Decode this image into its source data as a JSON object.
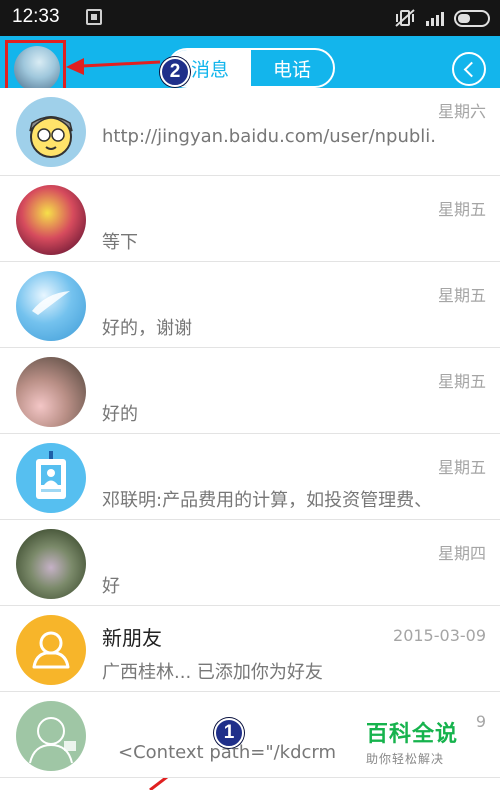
{
  "status_bar": {
    "time": "12:33"
  },
  "header": {
    "tabs": [
      {
        "label": "消息",
        "active": true
      },
      {
        "label": "电话",
        "active": false
      }
    ],
    "accent_color": "#13b5ec"
  },
  "annotations": {
    "badge_1": "1",
    "badge_2": "2",
    "highlight_color": "#e02020"
  },
  "conversations": [
    {
      "name": "",
      "date": "星期六",
      "message": "http://jingyan.baidu.com/user/npubli.",
      "avatar_icon": "cartoon-avatar"
    },
    {
      "name": "",
      "date": "星期五",
      "message": "等下",
      "avatar_icon": "gift-photo-avatar"
    },
    {
      "name": "",
      "date": "星期五",
      "message": "好的，谢谢",
      "avatar_icon": "feather-sky-avatar"
    },
    {
      "name": "",
      "date": "星期五",
      "message": "好的",
      "avatar_icon": "child-photo-avatar"
    },
    {
      "name": "",
      "date": "星期五",
      "message": "邓联明:产品费用的计算，如投资管理费、",
      "avatar_icon": "id-badge-avatar"
    },
    {
      "name": "",
      "date": "星期四",
      "message": "好",
      "avatar_icon": "garden-photo-avatar"
    },
    {
      "name": "新朋友",
      "date": "2015-03-09",
      "message": "广西桂林... 已添加你为好友",
      "avatar_icon": "new-friend-icon"
    },
    {
      "name": "",
      "date": "9",
      "message": "<Context path=\"/kdcrm",
      "avatar_icon": "sketch-avatar"
    }
  ],
  "watermark": {
    "title": "百科全说",
    "subtitle": "助你轻松解决"
  }
}
